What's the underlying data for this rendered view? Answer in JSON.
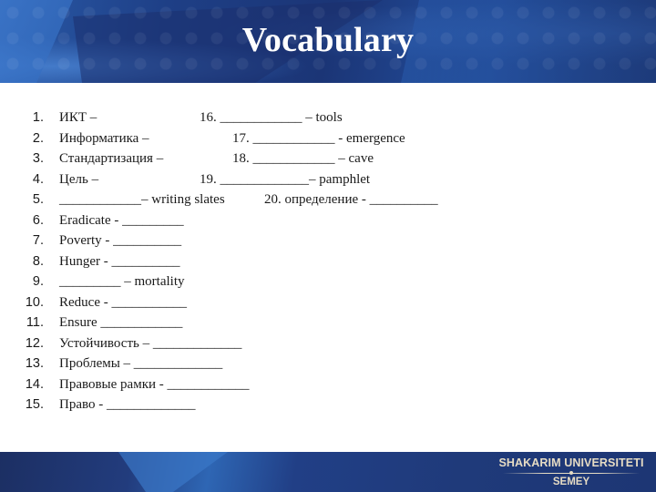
{
  "slide": {
    "title": "Vocabulary",
    "colors": {
      "header_bg": "#1e3c7c",
      "title_text": "#ffffff",
      "body_text": "#1a1a1a",
      "brand_text": "#e6dcc4"
    }
  },
  "items": [
    {
      "num": "1.",
      "text": "ИКТ –",
      "col2": "16. ____________ – tools"
    },
    {
      "num": "2.",
      "text": "Информатика –",
      "col2": "17. ____________ - emergence"
    },
    {
      "num": "3.",
      "text": "Стандартизация –",
      "col2": "18. ____________ – cave"
    },
    {
      "num": "4.",
      "text": "Цель –",
      "col2": "19. _____________– pamphlet"
    },
    {
      "num": "5.",
      "text": "____________– writing slates",
      "col2": "20. определение - __________"
    },
    {
      "num": "6.",
      "text": "Eradicate - _________"
    },
    {
      "num": "7.",
      "text": "Poverty - __________"
    },
    {
      "num": "8.",
      "text": "Hunger - __________"
    },
    {
      "num": "9.",
      "text": "_________ – mortality"
    },
    {
      "num": "10.",
      "text": "Reduce - ___________"
    },
    {
      "num": "11.",
      "text": "Ensure  ____________"
    },
    {
      "num": "12.",
      "text": "Устойчивость – _____________"
    },
    {
      "num": "13.",
      "text": "Проблемы – _____________"
    },
    {
      "num": "14.",
      "text": "Правовые рамки - ____________"
    },
    {
      "num": "15.",
      "text": "Право - _____________"
    }
  ],
  "footer": {
    "brand_name": "SHAKARIM UNIVERSITETI",
    "brand_city": "SEMEY"
  }
}
